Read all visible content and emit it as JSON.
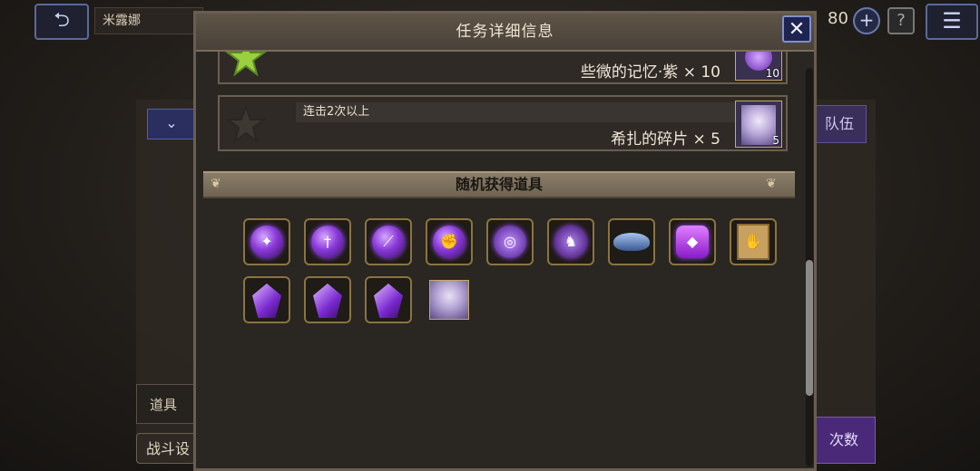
{
  "topbar": {
    "back_label": "⮌",
    "character_name": "米露娜",
    "stamina": "80",
    "plus_label": "+",
    "help_label": "?",
    "menu_label": "☰"
  },
  "background": {
    "dropdown_label": "⌄",
    "items_tab": "道具",
    "battle_button": "战斗设",
    "party_button": "队伍",
    "count_button": "次数"
  },
  "modal": {
    "title": "任务详细信息",
    "close_label": "✕",
    "rewards": [
      {
        "condition": "",
        "reward_text": "些微的记忆·紫 × 10",
        "quantity": "10",
        "star_achieved": true
      },
      {
        "condition": "连击2次以上",
        "reward_text": "希扎的碎片 × 5",
        "quantity": "5",
        "star_achieved": false
      }
    ],
    "section_title": "随机获得道具",
    "items": [
      {
        "icon": "purple-orb-icon",
        "glyph": "✦"
      },
      {
        "icon": "purple-orb-icon",
        "glyph": "†"
      },
      {
        "icon": "purple-orb-icon",
        "glyph": "⟋"
      },
      {
        "icon": "purple-orb-icon",
        "glyph": "✊"
      },
      {
        "icon": "purple-swirl-icon",
        "glyph": "◎"
      },
      {
        "icon": "purple-dragon-icon",
        "glyph": "♞"
      },
      {
        "icon": "blue-hat-icon",
        "glyph": ""
      },
      {
        "icon": "purple-jar-icon",
        "glyph": "◆"
      },
      {
        "icon": "scroll-icon",
        "glyph": "✋"
      },
      {
        "icon": "purple-gem-icon",
        "glyph": ""
      },
      {
        "icon": "purple-gem-icon",
        "glyph": ""
      },
      {
        "icon": "purple-gem-icon",
        "glyph": ""
      },
      {
        "icon": "character-portrait-icon",
        "glyph": ""
      }
    ]
  },
  "colors": {
    "accent_purple": "#8a3ad8",
    "frame_gold": "#8a7440",
    "close_blue": "#1e2350",
    "star_green": "#9ad040"
  }
}
